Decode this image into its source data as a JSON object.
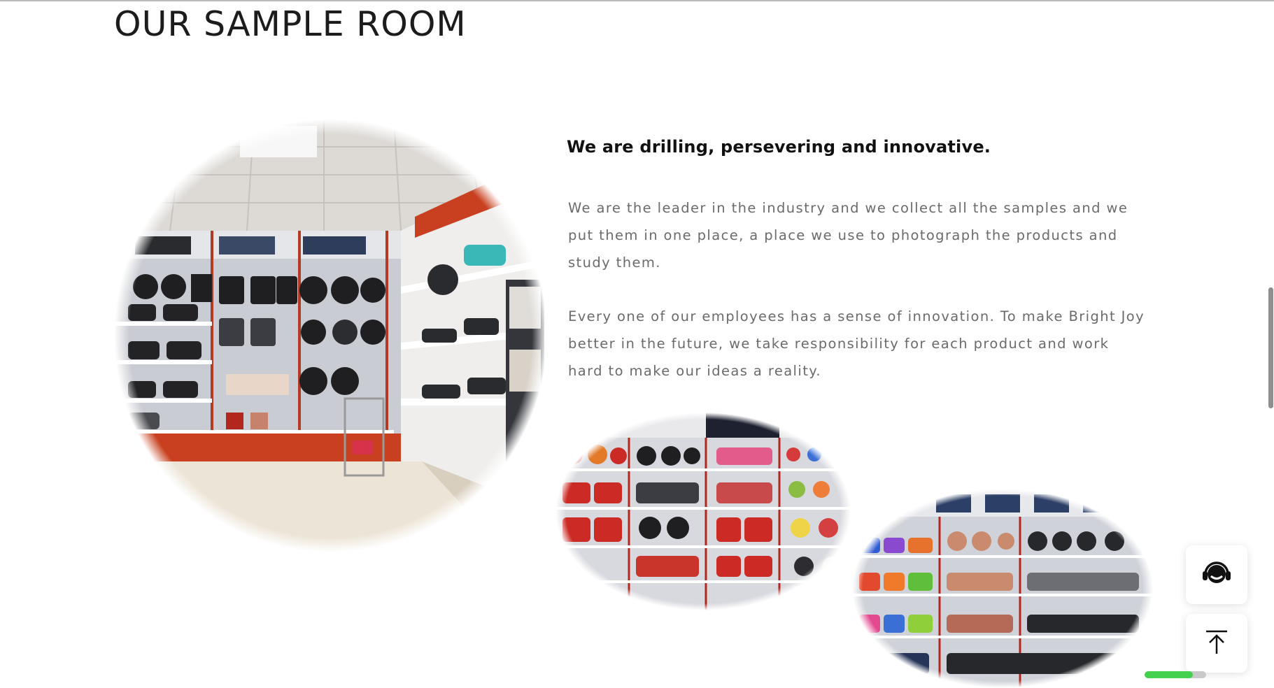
{
  "section": {
    "title": "OUR SAMPLE ROOM"
  },
  "content": {
    "headline": "We are drilling, persevering and innovative.",
    "paragraph_1": "We are the leader in the industry and we collect all the samples and we put them in one place, a place we use to photograph the products and study them.",
    "paragraph_2": "Every one of our employees has a sense of innovation. To make Bright Joy better in the future, we take responsibility for each product and work hard to make our ideas a reality."
  },
  "images": [
    {
      "name": "sample-room-wall-display-photo"
    },
    {
      "name": "sample-room-red-shelves-photo"
    },
    {
      "name": "sample-room-cookware-shelves-photo"
    }
  ],
  "floating_buttons": {
    "support_icon": "headset-icon",
    "back_to_top_icon": "arrow-up-icon"
  },
  "progress": {
    "fraction": 0.78,
    "fill_color": "#43d14e"
  },
  "colors": {
    "title": "#1c1c1c",
    "headline": "#111111",
    "body_text": "#6b6b6b",
    "background": "#ffffff"
  }
}
